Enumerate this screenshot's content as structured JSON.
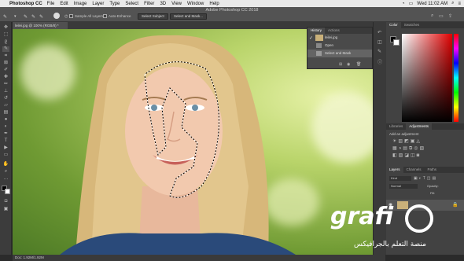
{
  "menubar": {
    "app_name": "Photoshop CC",
    "items": [
      "File",
      "Edit",
      "Image",
      "Layer",
      "Type",
      "Select",
      "Filter",
      "3D",
      "View",
      "Window",
      "Help"
    ],
    "clock": "Wed 11:02 AM"
  },
  "window_title": "Adobe Photoshop CC 2018",
  "options": {
    "sample_all_layers": "Sample All Layers",
    "auto_enhance": "Auto-Enhance",
    "select_subject": "Select Subject",
    "select_and_mask": "Select and Mask..."
  },
  "document": {
    "tab_label": "leilei.jpg @ 100% (RGB/8) *",
    "status": "Doc: 1.92M/1.92M"
  },
  "history": {
    "tabs": [
      "History",
      "Actions"
    ],
    "items": [
      "leilei.jpg",
      "Open",
      "Select and Mask"
    ]
  },
  "color_panel": {
    "tabs": [
      "Color",
      "Swatches"
    ]
  },
  "adjustments_panel": {
    "tabs": [
      "Libraries",
      "Adjustments"
    ],
    "hint": "Add an adjustment"
  },
  "layers_panel": {
    "tabs": [
      "Layers",
      "Channels",
      "Paths"
    ],
    "kind": "Kind",
    "normal": "Normal",
    "opacity": "Opacity:",
    "fill": "Fill:"
  },
  "watermark": {
    "brand": "grafi",
    "tagline": "منصة التعلم بالجرافيكس"
  }
}
